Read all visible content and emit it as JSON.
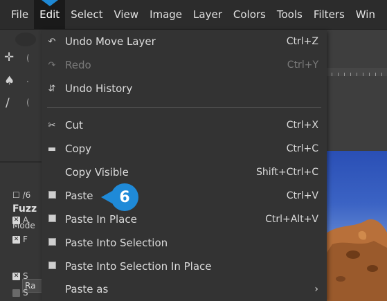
{
  "menubar": {
    "items": [
      "File",
      "Edit",
      "Select",
      "View",
      "Image",
      "Layer",
      "Colors",
      "Tools",
      "Filters",
      "Win"
    ],
    "active": "Edit"
  },
  "toolbox": {
    "tab_icons": "☐ /6",
    "tool_title": "Fuzz",
    "mode_label": "Mode",
    "options": [
      "A",
      "F",
      "S",
      "S"
    ],
    "ra_text": "Ra"
  },
  "edit_menu": {
    "items": [
      {
        "icon": "undo-icon",
        "glyph": "↶",
        "label": "Undo Move Layer",
        "shortcut": "Ctrl+Z",
        "enabled": true
      },
      {
        "icon": "redo-icon",
        "glyph": "↷",
        "label": "Redo",
        "shortcut": "Ctrl+Y",
        "enabled": false
      },
      {
        "icon": "undo-history-icon",
        "glyph": "⇵",
        "label": "Undo History",
        "shortcut": "",
        "enabled": true
      },
      {
        "icon": "cut-icon",
        "glyph": "✂",
        "label": "Cut",
        "shortcut": "Ctrl+X",
        "enabled": true
      },
      {
        "icon": "copy-icon",
        "glyph": "▭",
        "label": "Copy",
        "shortcut": "Ctrl+C",
        "enabled": true
      },
      {
        "icon": "",
        "glyph": "",
        "label": "Copy Visible",
        "shortcut": "Shift+Ctrl+C",
        "enabled": true
      },
      {
        "icon": "paste-icon",
        "glyph": "",
        "label": "Paste",
        "shortcut": "Ctrl+V",
        "enabled": true
      },
      {
        "icon": "paste-in-place-icon",
        "glyph": "",
        "label": "Paste In Place",
        "shortcut": "Ctrl+Alt+V",
        "enabled": true
      },
      {
        "icon": "paste-into-selection-icon",
        "glyph": "",
        "label": "Paste Into Selection",
        "shortcut": "",
        "enabled": true
      },
      {
        "icon": "paste-into-selection-in-place-icon",
        "glyph": "",
        "label": "Paste Into Selection In Place",
        "shortcut": "",
        "enabled": true
      },
      {
        "icon": "submenu-arrow-icon",
        "glyph": "",
        "label": "Paste as",
        "shortcut": "›",
        "enabled": true
      }
    ]
  },
  "callout": {
    "step": "6",
    "color": "#1f8ad8"
  },
  "colors": {
    "menu_bg": "#333333",
    "menubar_bg": "#2c2c2c",
    "accent": "#1f8ad8"
  }
}
